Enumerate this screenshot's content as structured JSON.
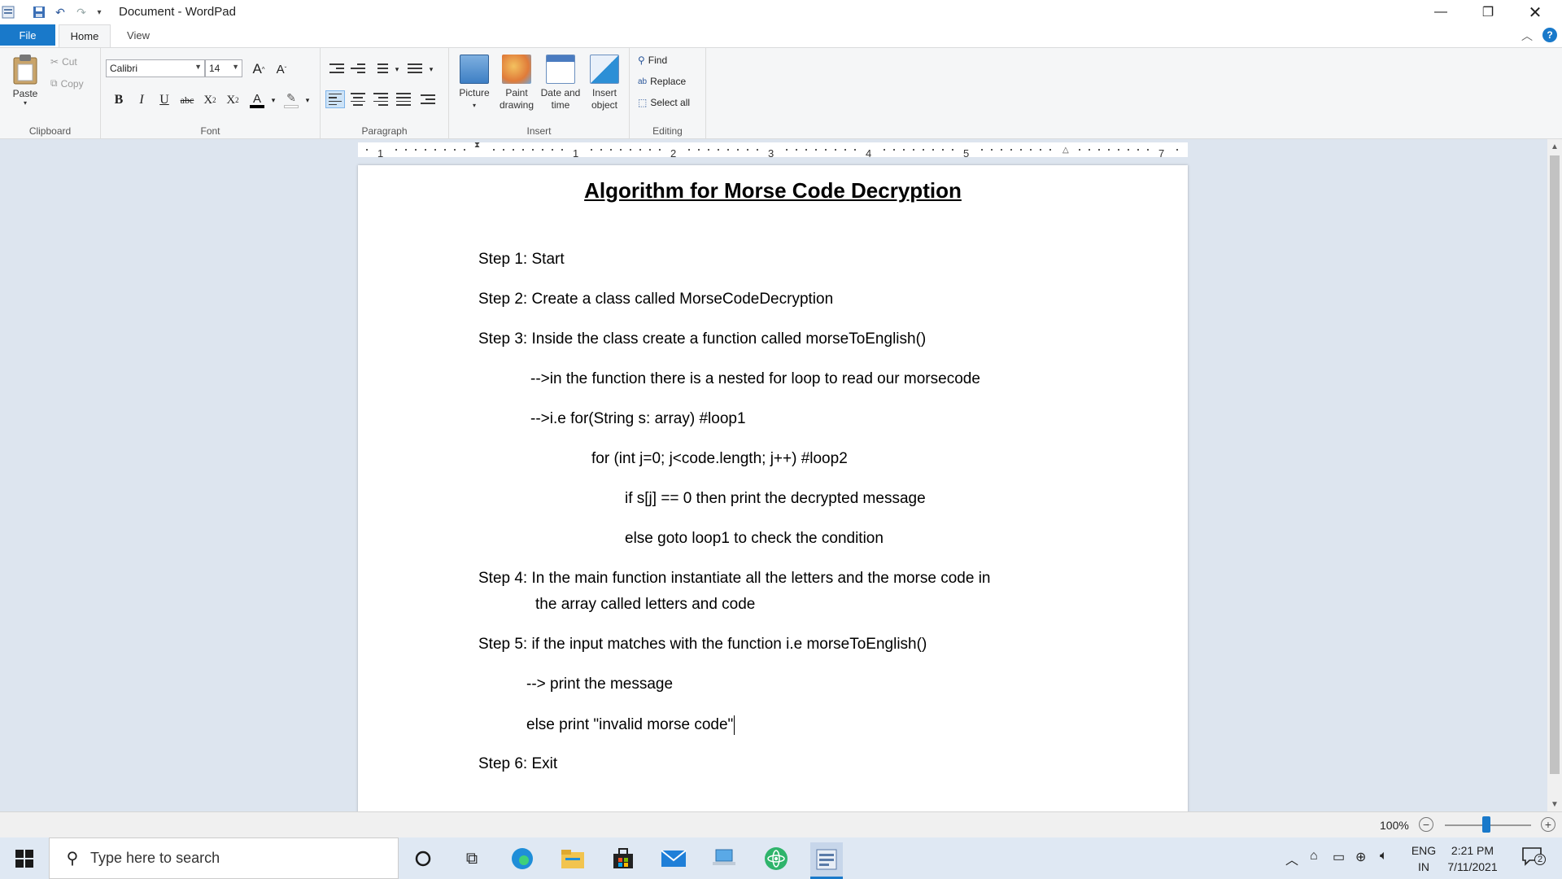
{
  "window": {
    "title": "Document - WordPad"
  },
  "tabs": {
    "file": "File",
    "home": "Home",
    "view": "View"
  },
  "ribbon": {
    "clipboard": {
      "label": "Clipboard",
      "paste": "Paste",
      "cut": "Cut",
      "copy": "Copy"
    },
    "font": {
      "label": "Font",
      "family": "Calibri",
      "size": "14"
    },
    "paragraph": {
      "label": "Paragraph"
    },
    "insert": {
      "label": "Insert",
      "picture": "Picture",
      "paint_line1": "Paint",
      "paint_line2": "drawing",
      "date_line1": "Date and",
      "date_line2": "time",
      "object_line1": "Insert",
      "object_line2": "object"
    },
    "editing": {
      "label": "Editing",
      "find": "Find",
      "replace": "Replace",
      "select_all": "Select all"
    }
  },
  "ruler": {
    "numbers": [
      "1",
      "1",
      "2",
      "3",
      "4",
      "5",
      "7"
    ]
  },
  "document": {
    "title": "Algorithm for Morse Code Decryption",
    "lines": [
      "Step 1: Start",
      "Step 2: Create a class called MorseCodeDecryption",
      "Step 3: Inside the class create a function called morseToEnglish()",
      "-->in the function there is a nested for loop to read our morsecode",
      "-->i.e for(String s: array) #loop1",
      "for (int j=0; j<code.length; j++) #loop2",
      "if s[j] == 0 then print the decrypted message",
      "else goto loop1 to check the condition",
      "Step 4: In the main function instantiate all the letters and the morse code in",
      "the array called letters and code",
      "Step 5: if the input matches with the function i.e morseToEnglish()",
      "--> print the message",
      "else print \"invalid morse code\"",
      "Step 6: Exit"
    ]
  },
  "statusbar": {
    "zoom": "100%",
    "zoom_fraction": 0.5
  },
  "taskbar": {
    "search_placeholder": "Type here to search",
    "lang_line1": "ENG",
    "lang_line2": "IN",
    "time": "2:21 PM",
    "date": "7/11/2021",
    "notification_count": "2"
  },
  "colors": {
    "accent": "#1979ca",
    "doc_background": "#dde5ef",
    "taskbar": "#dfe8f3"
  }
}
